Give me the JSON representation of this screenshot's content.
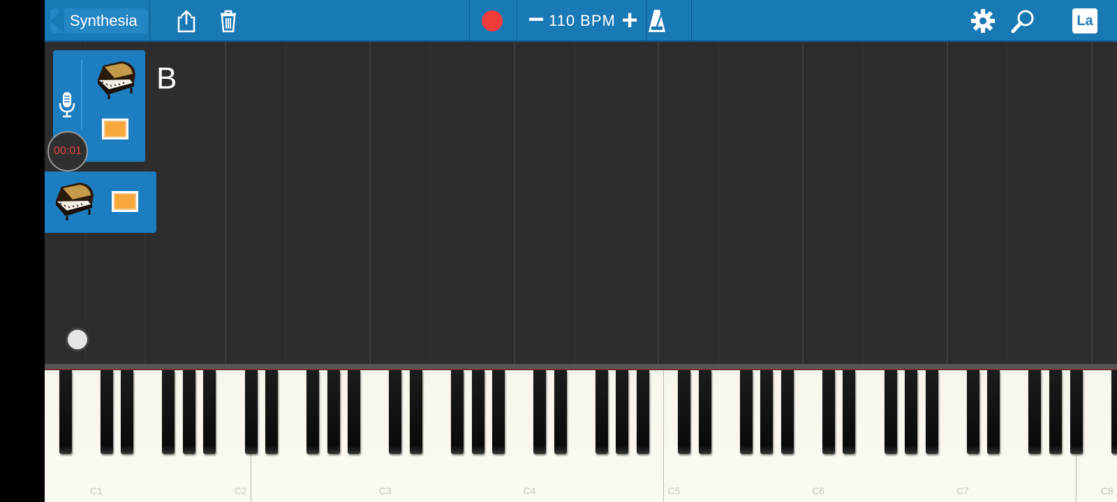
{
  "toolbar": {
    "back_label": "Synthesia",
    "share_icon": "share-icon",
    "trash_icon": "trash-icon",
    "record_color": "#f03b3b",
    "bpm_minus": "−",
    "bpm_value": "110 BPM",
    "bpm_plus": "+",
    "metronome_icon": "metronome-icon",
    "settings_icon": "gear-icon",
    "search_icon": "search-icon",
    "lang_label": "La"
  },
  "tracks": {
    "timer": "00:01",
    "hand_label": "B",
    "swatch_color": "#f8a83a",
    "track_color": "#1c7dc0"
  },
  "keyboard": {
    "labels": [
      "C1",
      "C2",
      "C3",
      "C4",
      "C5",
      "C6",
      "C7",
      "C8"
    ]
  }
}
